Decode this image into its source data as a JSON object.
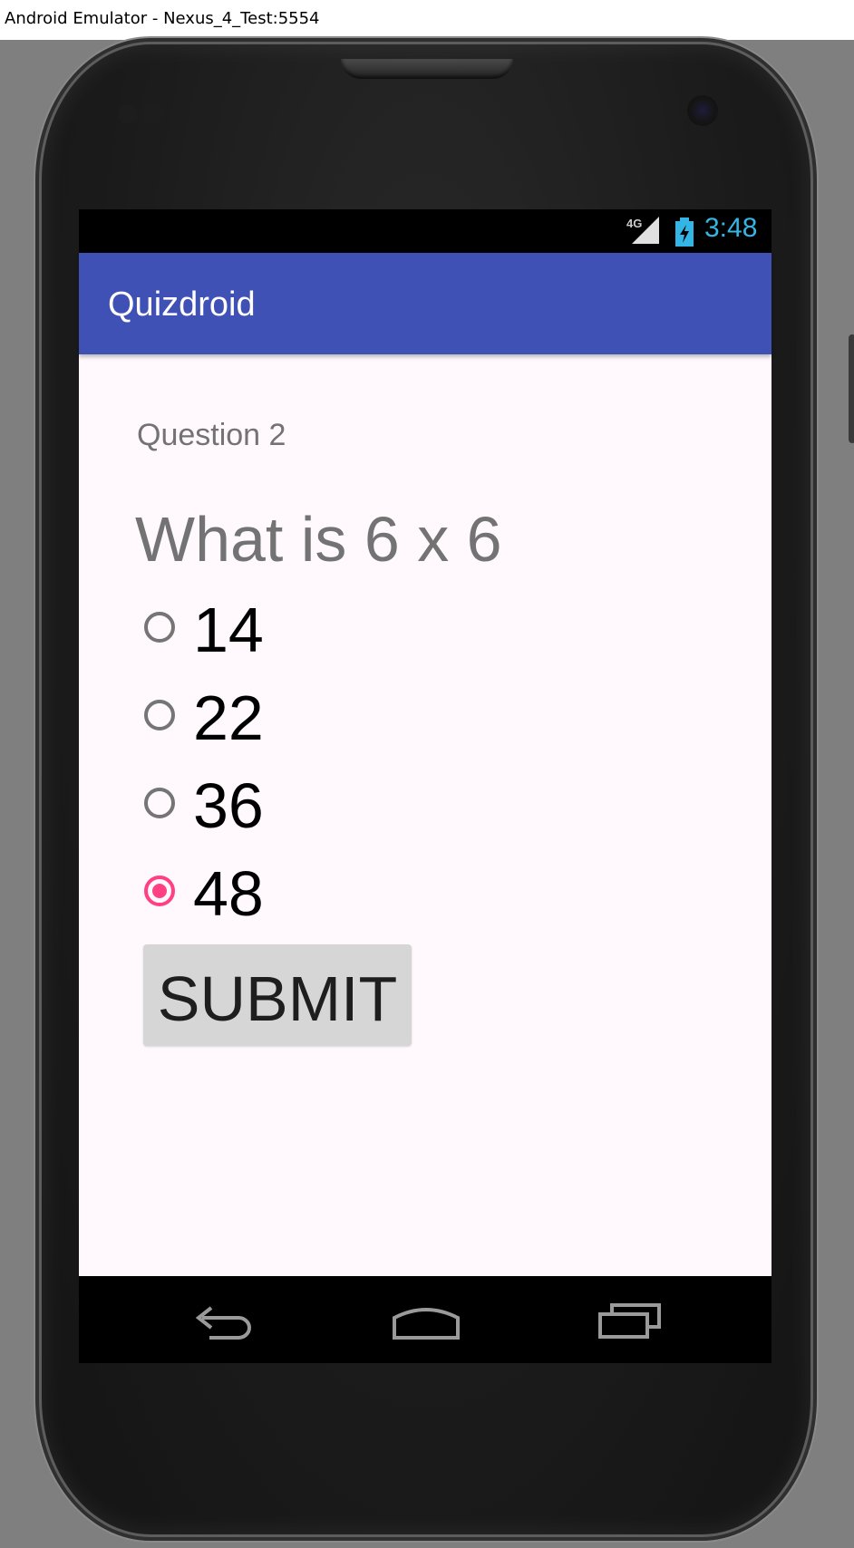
{
  "window": {
    "title": "Android Emulator - Nexus_4_Test:5554"
  },
  "status_bar": {
    "network": "4G",
    "time": "3:48",
    "clock_color": "#33b5e5"
  },
  "app_bar": {
    "title": "Quizdroid",
    "color": "#3f51b5"
  },
  "quiz": {
    "question_number": "Question 2",
    "question_text": "What is 6 x 6",
    "options": [
      {
        "label": "14",
        "selected": false
      },
      {
        "label": "22",
        "selected": false
      },
      {
        "label": "36",
        "selected": false
      },
      {
        "label": "48",
        "selected": true
      }
    ],
    "selected_color": "#ff4081",
    "submit_label": "SUBMIT"
  },
  "nav_bar": {
    "icons": [
      "back-icon",
      "home-icon",
      "recents-icon"
    ]
  }
}
